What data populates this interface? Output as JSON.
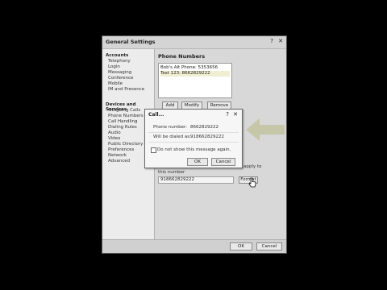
{
  "window": {
    "title": "General Settings",
    "help_label": "?",
    "close_label": "✕"
  },
  "sidebar": {
    "accounts_header": "Accounts",
    "accounts": [
      "Telephony",
      "Login",
      "Messaging",
      "Conference",
      "Mobile",
      "IM and Presence"
    ],
    "devices_header": "Devices and Services",
    "devices": [
      "Outgoing Calls",
      "Phone Numbers",
      "Call Handling",
      "Dialing Rules",
      "Audio",
      "Video",
      "Public Directory",
      "Preferences",
      "Network",
      "Advanced"
    ]
  },
  "main": {
    "title": "Phone Numbers",
    "numbers": [
      "Bob's Alt Phone: 5353656",
      "Test 123: 8662829222"
    ],
    "add_label": "Add",
    "modify_label": "Modify",
    "remove_label": "Remove",
    "apply_fragment": "apply to",
    "this_number_label": "this number",
    "formatted_value": "918662829222",
    "format_button_label": "Format"
  },
  "footer": {
    "ok_label": "OK",
    "cancel_label": "Cancel"
  },
  "dialog": {
    "title": "Call...",
    "help_label": "?",
    "close_label": "✕",
    "phone_label": "Phone number:",
    "phone_value": "8662829222",
    "dialed_label": "Will be dialed as:",
    "dialed_value": "918662829222",
    "dont_show_label": "Do not show this message again.",
    "ok_label": "OK",
    "cancel_label": "Cancel"
  },
  "colors": {
    "highlight_arrow": "#c6c6a8",
    "selected_row": "#f0eed0"
  }
}
